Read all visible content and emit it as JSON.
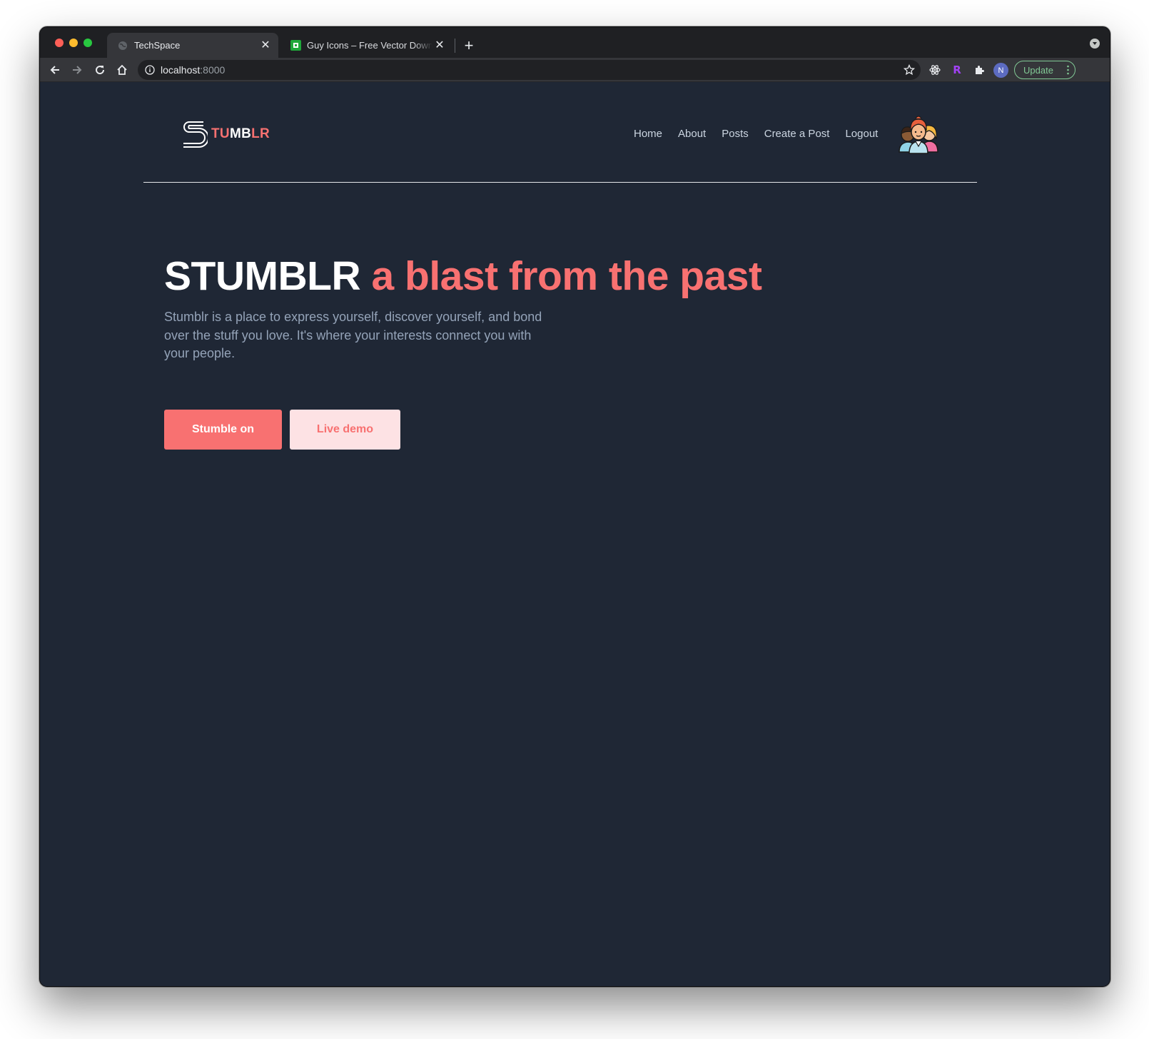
{
  "browser": {
    "tabs": [
      {
        "title": "TechSpace",
        "active": true,
        "icon": "globe-icon"
      },
      {
        "title": "Guy Icons – Free Vector Download",
        "active": false,
        "icon": "freepik-icon"
      }
    ],
    "url_host": "localhost",
    "url_port": ":8000",
    "update_label": "Update",
    "profile_initial": "N",
    "extension_r_label": "R"
  },
  "site": {
    "logo_part1": "TU",
    "logo_part2": "MB",
    "logo_part3": "LR",
    "nav": [
      "Home",
      "About",
      "Posts",
      "Create a Post",
      "Logout"
    ]
  },
  "hero": {
    "title_brand": "STUMBLR",
    "title_tagline": "a blast from the past",
    "description": "Stumblr is a place to express yourself, discover yourself, and bond over the stuff you love. It's where your interests connect you with your people.",
    "primary_button": "Stumble on",
    "secondary_button": "Live demo"
  },
  "colors": {
    "accent": "#f87171",
    "background": "#1f2735",
    "secondary_button_bg": "#fde2e4"
  }
}
